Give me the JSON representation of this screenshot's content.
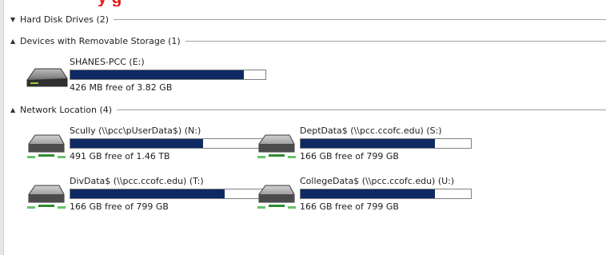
{
  "title_text": "y  g",
  "groups": {
    "hard_disk": {
      "label": "Hard Disk Drives (2)"
    },
    "removable": {
      "label": "Devices with Removable Storage (1)"
    },
    "network": {
      "label": "Network Location (4)"
    }
  },
  "drives": [
    {
      "name": "SHANES-PCC (E:)",
      "free": "426 MB free of 3.82 GB",
      "used_fraction": 0.89
    },
    {
      "name": "Scully (\\\\pcc\\pUserData$) (N:)",
      "free": "491 GB free of 1.46 TB",
      "used_fraction": 0.68
    },
    {
      "name": "DeptData$ (\\\\pcc.ccofc.edu) (S:)",
      "free": "166 GB free of 799 GB",
      "used_fraction": 0.79
    },
    {
      "name": "DivData$ (\\\\pcc.ccofc.edu) (T:)",
      "free": "166 GB free of 799 GB",
      "used_fraction": 0.79
    },
    {
      "name": "CollegeData$ (\\\\pcc.ccofc.edu) (U:)",
      "free": "166 GB free of 799 GB",
      "used_fraction": 0.79
    }
  ]
}
